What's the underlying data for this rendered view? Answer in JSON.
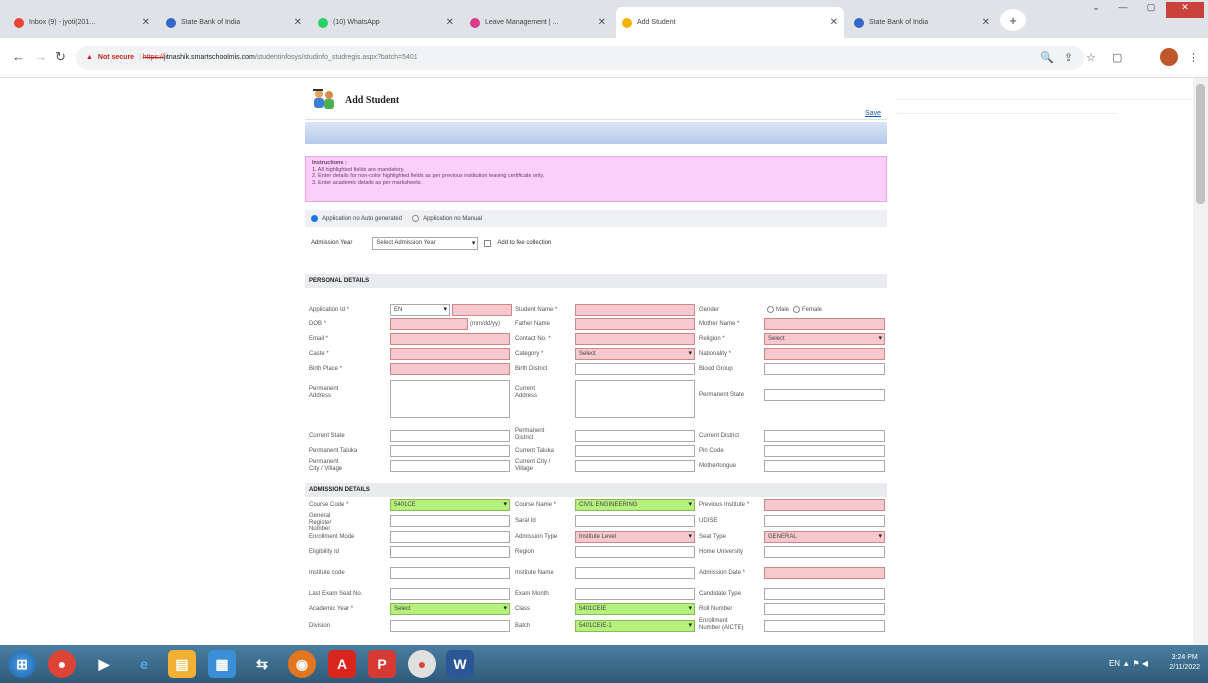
{
  "browser": {
    "tabs": [
      {
        "title": "Inbox (9) - jyoti(201...",
        "favicon_color": "#ea4335",
        "active": false
      },
      {
        "title": "State Bank of India",
        "favicon_color": "#3366cc",
        "active": false
      },
      {
        "title": "(10) WhatsApp",
        "favicon_color": "#25d366",
        "active": false
      },
      {
        "title": "Leave Management | ...",
        "favicon_color": "#d93c8a",
        "active": false
      },
      {
        "title": "Add Student",
        "favicon_color": "#f4b400",
        "active": true
      },
      {
        "title": "State Bank of India",
        "favicon_color": "#3366cc",
        "active": false
      }
    ],
    "new_tab": "+",
    "address": {
      "security": "Not secure",
      "scheme": "https://",
      "domain": "jitnashik.smartschoolmis.com",
      "path": "/studentinfosys/studinfo_studregis.aspx?batch=5401"
    }
  },
  "form": {
    "title": "Add Student",
    "save_label": "Save",
    "instructions": {
      "title": "Instructions :",
      "lines": [
        "1. All highlighted fields are mandatory.",
        "2. Enter details for non-color highlighted fields as per previous institution leaving certificate only.",
        "3. Enter academic details as per marksheets."
      ]
    },
    "appno_options": [
      "Application no Auto generated",
      "Application no Manual"
    ],
    "admission_year": {
      "label": "Admission Year",
      "value": "Select Admission Year",
      "fee_label": "Add to fee collection"
    },
    "sections": {
      "personal": "PERSONAL DETAILS",
      "admission": "ADMISSION DETAILS"
    },
    "personal": {
      "application_id": "Application Id *",
      "application_prefix": "EN",
      "student_name": "Student Name *",
      "gender": "Gender",
      "male": "Male",
      "female": "Female",
      "dob": "DOB *",
      "dob_hint": "(mm/dd/yy)",
      "father_name": "Father Name",
      "mother_name": "Mother Name *",
      "email": "Email *",
      "contact_no": "Contact No. *",
      "religion": "Religion *",
      "religion_value": "Select",
      "caste": "Caste *",
      "category": "Category *",
      "category_value": "Select",
      "nationality": "Nationality *",
      "birth_place": "Birth Place *",
      "birth_district": "Birth District",
      "blood_group": "Blood Group",
      "permanent_address": "Permanent Address",
      "current_address": "Current Address",
      "permanent_state": "Permanent State",
      "current_state": "Current State",
      "permanent_district": "Permanent District",
      "current_district": "Current District",
      "permanent_taluka": "Permanent Taluka",
      "current_taluka": "Current Taluka",
      "pin_code": "Pin Code",
      "permanent_city": "Permanent City / Village",
      "current_city": "Current City / Village",
      "mothertongue": "Mothertongue"
    },
    "admission": {
      "course_code": "Course Code *",
      "course_code_value": "5401CE",
      "course_name": "Course Name *",
      "course_name_value": "CIVIL ENGINEERING",
      "previous_institute": "Previous Institute *",
      "general_register": "General Register Number",
      "saral_id": "Saral Id",
      "udise": "UDISE",
      "enrollment_mode": "Enrollment Mode",
      "admission_type": "Admission Type",
      "admission_type_value": "Institute Level",
      "seat_type": "Seat Type",
      "seat_type_value": "GENERAL",
      "eligibility_id": "Eligibility Id",
      "region": "Region",
      "home_university": "Home University",
      "institute_code": "Institute code",
      "institute_name": "Institute Name",
      "admission_date": "Admission Date *",
      "last_exam_seat": "Last Exam Seat No.",
      "exam_month": "Exam Month",
      "candidate_type": "Candidate Type",
      "academic_year": "Academic Year *",
      "academic_year_value": "Select",
      "class": "Class",
      "class_value": "5401CEIE",
      "roll_number": "Roll Number",
      "division": "Division",
      "batch": "Batch",
      "batch_value": "5401CEIE-1",
      "enrollment_no": "Enrollment Number (AICTE)"
    }
  },
  "taskbar": {
    "time": "3:24 PM",
    "date": "2/11/2022",
    "lang": "EN"
  }
}
